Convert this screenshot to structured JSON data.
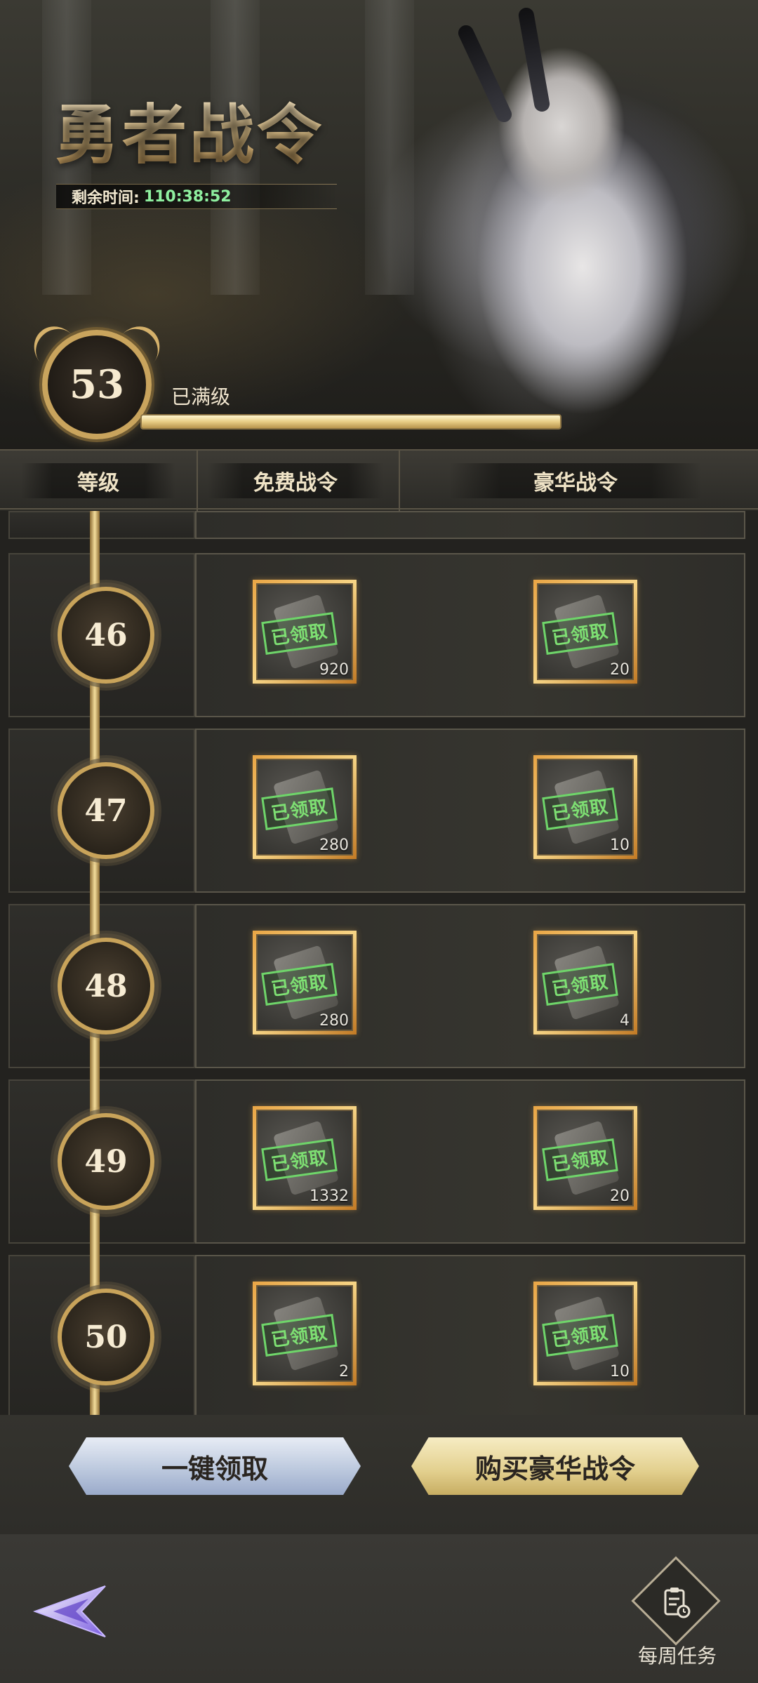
{
  "banner": {
    "title": "勇者战令",
    "timer_label": "剩余时间:",
    "timer_value": "110:38:52",
    "current_level": "53",
    "status": "已满级",
    "progress": 1.0
  },
  "columns": {
    "level": "等级",
    "free": "免费战令",
    "deluxe": "豪华战令"
  },
  "rows": [
    {
      "level": "46",
      "free": {
        "status": "已领取",
        "qty": "920"
      },
      "deluxe": {
        "status": "已领取",
        "qty": "20"
      }
    },
    {
      "level": "47",
      "free": {
        "status": "已领取",
        "qty": "280"
      },
      "deluxe": {
        "status": "已领取",
        "qty": "10"
      }
    },
    {
      "level": "48",
      "free": {
        "status": "已领取",
        "qty": "280"
      },
      "deluxe": {
        "status": "已领取",
        "qty": "4"
      }
    },
    {
      "level": "49",
      "free": {
        "status": "已领取",
        "qty": "1332"
      },
      "deluxe": {
        "status": "已领取",
        "qty": "20"
      }
    },
    {
      "level": "50",
      "free": {
        "status": "已领取",
        "qty": "2"
      },
      "deluxe": {
        "status": "已领取",
        "qty": "10"
      }
    }
  ],
  "buttons": {
    "claim_all": "一键领取",
    "buy_deluxe": "购买豪华战令"
  },
  "footer": {
    "weekly_tasks": "每周任务",
    "back_icon": "back-arrow-icon",
    "weekly_icon": "task-clipboard-icon"
  },
  "colors": {
    "accent_gold": "#c9a45d",
    "timer_green": "#8ff0a0",
    "claimed_green": "#7ee073"
  }
}
